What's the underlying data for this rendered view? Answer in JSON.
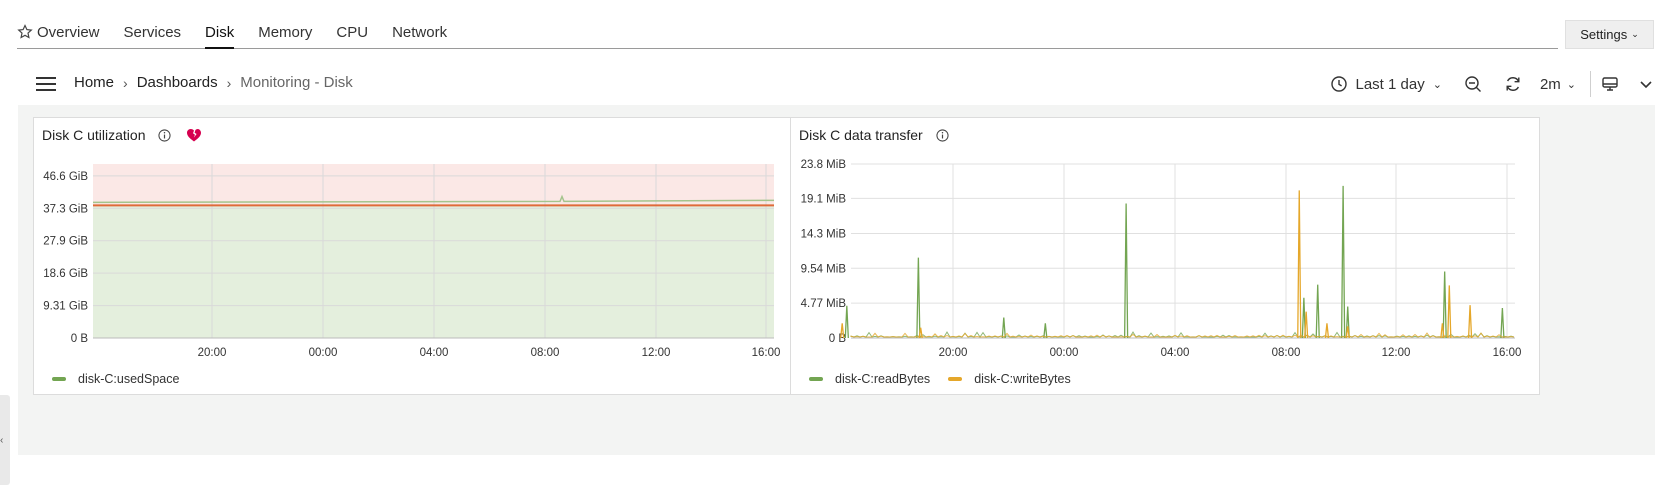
{
  "tabs": [
    {
      "label": "Overview",
      "icon": "star-icon"
    },
    {
      "label": "Services"
    },
    {
      "label": "Disk",
      "active": true
    },
    {
      "label": "Memory"
    },
    {
      "label": "CPU"
    },
    {
      "label": "Network"
    }
  ],
  "settings_label": "Settings",
  "breadcrumb": {
    "home": "Home",
    "dashboards": "Dashboards",
    "current": "Monitoring - Disk"
  },
  "toolbar": {
    "time_range": "Last 1 day",
    "refresh_interval": "2m",
    "icons": [
      "clock-icon",
      "zoom-out-icon",
      "refresh-icon",
      "display-icon",
      "chevron-down-icon"
    ]
  },
  "colors": {
    "green": "#73a552",
    "yellow": "#e5a72a",
    "threshold_red": "#e06a3a",
    "red_band": "#fbe8e6",
    "green_band": "#e4efdd",
    "heart": "#d6004f"
  },
  "panels": [
    {
      "title": "Disk C utilization",
      "legend": [
        "disk-C:usedSpace"
      ]
    },
    {
      "title": "Disk C data transfer",
      "legend": [
        "disk-C:readBytes",
        "disk-C:writeBytes"
      ]
    }
  ],
  "chart_data": [
    {
      "type": "area",
      "title": "Disk C utilization",
      "y_ticks": [
        "46.6 GiB",
        "37.3 GiB",
        "27.9 GiB",
        "18.6 GiB",
        "9.31 GiB",
        "0 B"
      ],
      "x_ticks": [
        "20:00",
        "00:00",
        "04:00",
        "08:00",
        "12:00",
        "16:00"
      ],
      "ylim_gib": [
        0,
        50
      ],
      "threshold_gib": 37.3,
      "red_band_gib": [
        37.3,
        50
      ],
      "series": [
        {
          "name": "disk-C:usedSpace",
          "value_gib": 38.4,
          "spike_at": "08:30",
          "spike_gib": 39.5
        }
      ]
    },
    {
      "type": "line",
      "title": "Disk C data transfer",
      "y_ticks": [
        "23.8 MiB",
        "19.1 MiB",
        "14.3 MiB",
        "9.54 MiB",
        "4.77 MiB",
        "0 B"
      ],
      "x_ticks": [
        "20:00",
        "00:00",
        "04:00",
        "08:00",
        "12:00",
        "16:00"
      ],
      "ylim_mib": [
        0,
        23.8
      ],
      "series": [
        {
          "name": "disk-C:readBytes",
          "spikes": [
            [
              "18:45",
              11.0
            ],
            [
              "21:50",
              2.8
            ],
            [
              "23:20",
              2.0
            ],
            [
              "02:15",
              18.4
            ],
            [
              "08:40",
              5.5
            ],
            [
              "09:10",
              7.3
            ],
            [
              "10:05",
              20.8
            ],
            [
              "10:15",
              4.3
            ],
            [
              "13:45",
              9.1
            ],
            [
              "15:50",
              4.1
            ],
            [
              "16:10",
              4.4
            ]
          ]
        },
        {
          "name": "disk-C:writeBytes",
          "spikes": [
            [
              "18:50",
              1.4
            ],
            [
              "08:30",
              20.2
            ],
            [
              "08:45",
              3.6
            ],
            [
              "09:30",
              2.0
            ],
            [
              "10:15",
              1.6
            ],
            [
              "13:40",
              2.0
            ],
            [
              "13:55",
              7.2
            ],
            [
              "14:40",
              4.5
            ],
            [
              "16:00",
              2.0
            ]
          ]
        }
      ]
    }
  ]
}
